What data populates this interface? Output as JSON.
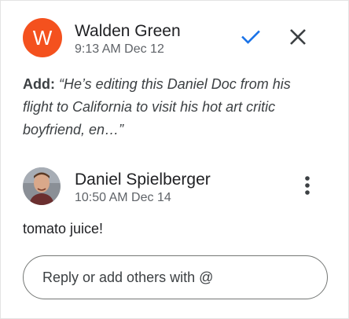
{
  "comment1": {
    "avatar_letter": "W",
    "author": "Walden Green",
    "timestamp": "9:13 AM Dec 12",
    "action_label": "Add:",
    "quote": "“He’s editing this Daniel Doc from his flight to California to visit his hot art critic boyfriend, en…”",
    "resolve_icon": "checkmark-icon",
    "close_icon": "close-icon"
  },
  "comment2": {
    "author": "Daniel Spielberger",
    "timestamp": "10:50 AM Dec 14",
    "body": "tomato juice!",
    "more_icon": "more-vert-icon"
  },
  "reply": {
    "placeholder": "Reply or add others with @"
  },
  "colors": {
    "avatar_bg": "#f4511e",
    "accent": "#1a73e8",
    "text_secondary": "#5f6368"
  }
}
